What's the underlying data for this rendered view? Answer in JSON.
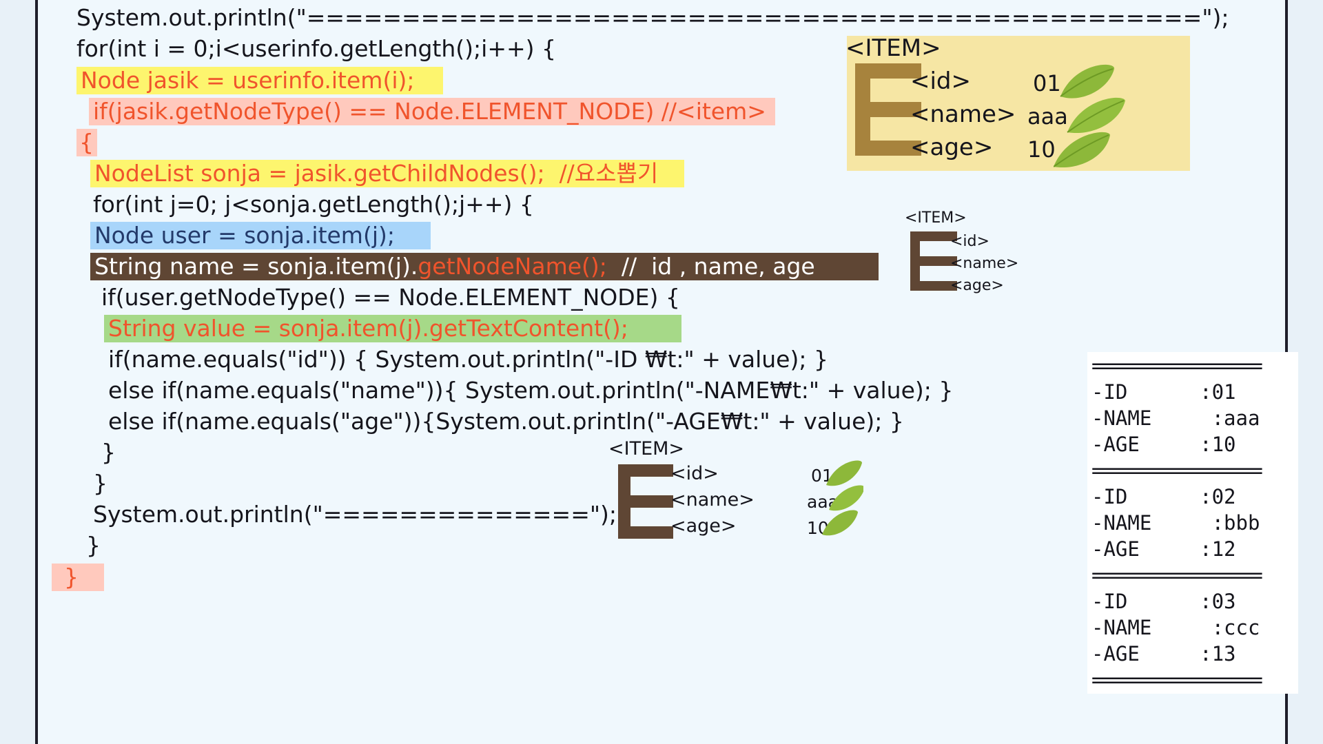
{
  "code": {
    "line1": "System.out.println(\"===============================================\");",
    "line2": "for(int i = 0;i<userinfo.getLength();i++) {",
    "line3": "Node jasik = userinfo.item(i);",
    "line4": "if(jasik.getNodeType() == Node.ELEMENT_NODE) //<item>",
    "line5": "{",
    "line6": "NodeList sonja = jasik.getChildNodes();  //요소뽑기",
    "line7": "for(int j=0; j<sonja.getLength();j++) {",
    "line8": "Node user = sonja.item(j);",
    "line9a": "String name = sonja.item(j).",
    "line9b": "getNodeName();",
    "line9c": "  //  id , name, age",
    "line10": "if(user.getNodeType() == Node.ELEMENT_NODE) {",
    "line11": "String value = sonja.item(j).getTextContent();",
    "line12": "if(name.equals(\"id\")) { System.out.println(\"-ID ₩t:\" + value); }",
    "line13": "else if(name.equals(\"name\")){ System.out.println(\"-NAME₩t:\" + value); }",
    "line14": "else if(name.equals(\"age\")){System.out.println(\"-AGE₩t:\" + value); }",
    "line15": "}",
    "line16": "}",
    "line17": "System.out.println(\"==============\");",
    "line18": "}",
    "line19": "}"
  },
  "diagram_large": {
    "title": "<ITEM>",
    "tags": [
      "<id>",
      "<name>",
      "<age>"
    ],
    "values": [
      "01",
      "aaa",
      "10"
    ]
  },
  "diagram_small": {
    "title": "<ITEM>",
    "tags": [
      "<id>",
      "<name>",
      "<age>"
    ]
  },
  "diagram_bottom": {
    "title": "<ITEM>",
    "tags": [
      "<id>",
      "<name>",
      "<age>"
    ],
    "values": [
      "01",
      "aaa",
      "10"
    ]
  },
  "console": {
    "separator": "=================",
    "records": [
      {
        "id": "-ID      :01",
        "name": "-NAME     :aaa",
        "age": "-AGE     :10"
      },
      {
        "id": "-ID      :02",
        "name": "-NAME     :bbb",
        "age": "-AGE     :12"
      },
      {
        "id": "-ID      :03",
        "name": "-NAME     :ccc",
        "age": "-AGE     :13"
      }
    ]
  },
  "colors": {
    "highlight_yellow": "#fdf56e",
    "highlight_pink": "#ffc9bd",
    "highlight_blue": "#a8d5fa",
    "highlight_dark": "#5f4634",
    "highlight_green": "#a6d988",
    "accent_orange": "#f0542c",
    "diagram_bg": "#f6e6a4",
    "bracket_gold": "#a7833d",
    "bracket_brown": "#5f4634",
    "leaf_green": "#8db83a"
  }
}
